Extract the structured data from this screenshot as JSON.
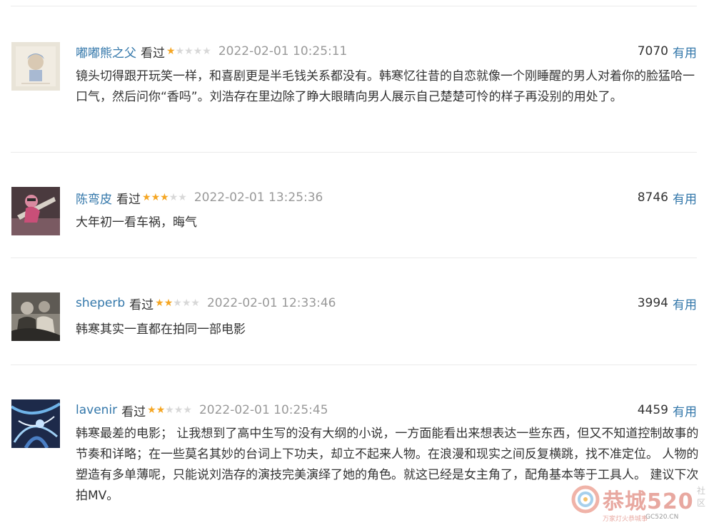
{
  "comments": [
    {
      "user": "嘟嘟熊之父",
      "status": "看过",
      "rating": 1,
      "time": "2022-02-01 10:25:11",
      "votes": "7070",
      "vote_label": "有用",
      "content": "镜头切得跟开玩笑一样，和喜剧更是半毛钱关系都没有。韩寒忆往昔的自恋就像一个刚睡醒的男人对着你的脸猛哈一口气，然后问你“香吗”。刘浩存在里边除了睁大眼睛向男人展示自己楚楚可怜的样子再没别的用处了。"
    },
    {
      "user": "陈弯皮",
      "status": "看过",
      "rating": 3,
      "time": "2022-02-01 13:25:36",
      "votes": "8746",
      "vote_label": "有用",
      "content": "大年初一看车祸，晦气"
    },
    {
      "user": "sheperb",
      "status": "看过",
      "rating": 2,
      "time": "2022-02-01 12:33:46",
      "votes": "3994",
      "vote_label": "有用",
      "content": "韩寒其实一直都在拍同一部电影"
    },
    {
      "user": "lavenir",
      "status": "看过",
      "rating": 2,
      "time": "2022-02-01 10:25:45",
      "votes": "4459",
      "vote_label": "有用",
      "content": "韩寒最差的电影； 让我想到了高中生写的没有大纲的小说，一方面能看出来想表达一些东西，但又不知道控制故事的节奏和详略；在一些莫名其妙的台词上下功夫，却立不起来人物。在浪漫和现实之间反复横跳，找不准定位。 人物的塑造有多单薄呢，只能说刘浩存的演技完美演绎了她的角色。就这已经是女主角了，配角基本等于工具人。 建议下次拍MV。"
    }
  ],
  "watermark": {
    "main": "恭城520",
    "side": "社区",
    "sub": "万家灯火恭城事",
    "url": "GC520.CN"
  },
  "colors": {
    "link": "#3377aa",
    "text": "#333333",
    "meta": "#999999",
    "star_on": "#f5a623",
    "star_off": "#d8d8d8"
  },
  "icons": {
    "star": "star-icon",
    "watermark_logo": "swirl-logo-icon"
  }
}
